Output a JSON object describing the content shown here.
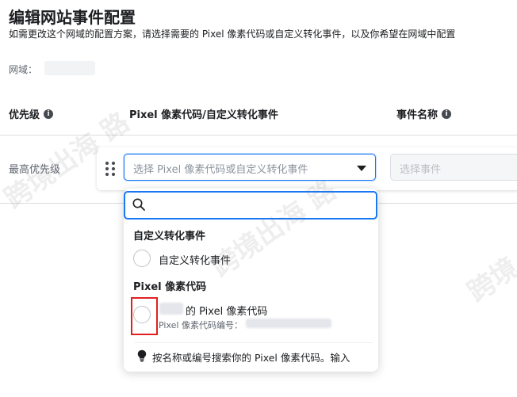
{
  "page": {
    "title": "编辑网站事件配置",
    "description": "如需更改这个网域的配置方案，请选择需要的 Pixel 像素代码或自定义转化事件，以及你希望在网域中配置",
    "domain_label": "网域："
  },
  "table": {
    "headers": {
      "priority": "优先级",
      "pixel_event": "Pixel 像素代码/自定义转化事件",
      "event_name": "事件名称"
    },
    "row": {
      "priority": "最高优先级",
      "select_placeholder": "选择 Pixel 像素代码或自定义转化事件",
      "event_placeholder": "选择事件"
    }
  },
  "dropdown": {
    "search_placeholder": "",
    "groups": [
      {
        "label": "自定义转化事件",
        "options": [
          {
            "label": "自定义转化事件"
          }
        ]
      },
      {
        "label": "Pixel 像素代码",
        "options": [
          {
            "label": "的 Pixel 像素代码",
            "sub_label": "Pixel 像素代码编号："
          }
        ]
      }
    ],
    "tip": "按名称或编号搜索你的 Pixel 像素代码。输入"
  },
  "watermark": {
    "text_1": "跨境出海 路",
    "text_2": "跨境出海 路",
    "text_3": "跨境"
  },
  "colors": {
    "accent": "#1877f2",
    "highlight": "#e02020",
    "text": "#1c1e21",
    "muted": "#606770"
  }
}
